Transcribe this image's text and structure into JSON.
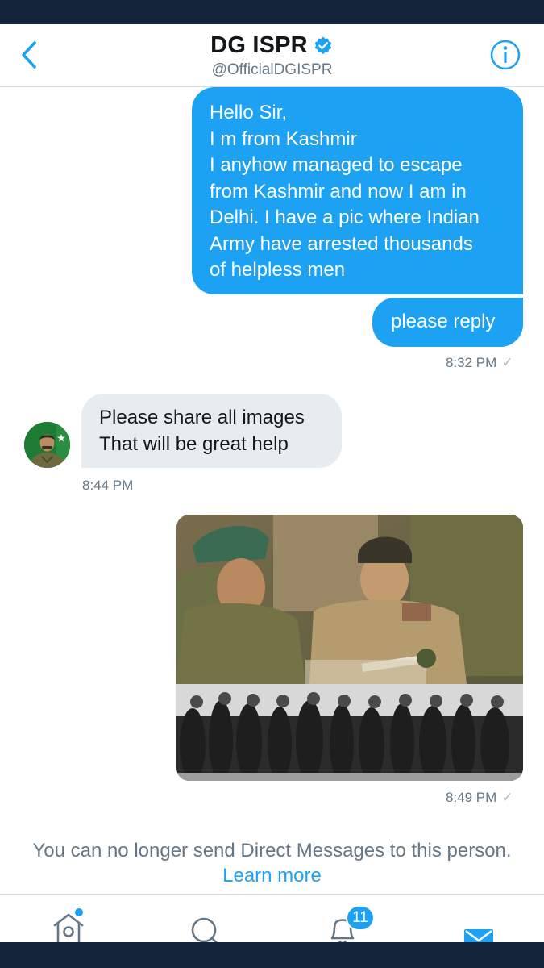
{
  "header": {
    "title": "DG ISPR",
    "handle": "@OfficialDGISPR"
  },
  "messages": [
    {
      "direction": "outgoing",
      "lines": [
        "Hello Sir,",
        "I m from Kashmir",
        "I anyhow managed to escape",
        "from Kashmir and now I am in",
        "Delhi. I have a pic where Indian",
        "Army have arrested thousands",
        "of helpless men"
      ]
    },
    {
      "direction": "outgoing",
      "lines": [
        "please reply"
      ],
      "time": "8:32 PM"
    },
    {
      "direction": "incoming",
      "lines": [
        "Please share all images",
        "That will be great help"
      ],
      "time": "8:44 PM"
    },
    {
      "direction": "outgoing",
      "type": "image",
      "time": "8:49 PM"
    }
  ],
  "read_mark": "✓",
  "footer": {
    "notice": "You can no longer send Direct Messages to this person.",
    "learn_more": "Learn more"
  },
  "tabbar": {
    "notifications_badge": "11",
    "active_tab": "messages"
  },
  "colors": {
    "accent": "#1da1f2",
    "incoming_bubble": "#e6ecf0",
    "status_bar": "#12243a",
    "secondary_text": "#657786"
  }
}
